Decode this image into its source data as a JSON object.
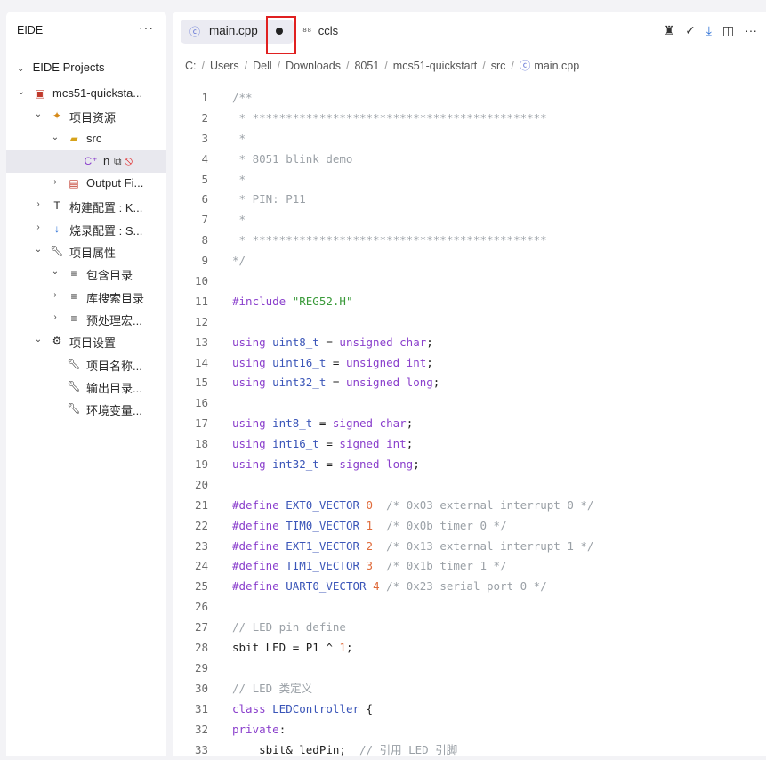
{
  "sidebar": {
    "title": "EIDE",
    "more": "···",
    "section": "EIDE Projects",
    "items": [
      {
        "label": "mcs51-quicksta...",
        "depth": 0,
        "chev": "⌄",
        "icon": "project-icon"
      },
      {
        "label": "项目资源",
        "depth": 1,
        "chev": "⌄",
        "icon": "resources-icon"
      },
      {
        "label": "src",
        "depth": 2,
        "chev": "⌄",
        "icon": "folder-icon"
      },
      {
        "label": "n",
        "depth": 3,
        "chev": "",
        "icon": "cpp-file-icon",
        "selected": true
      },
      {
        "label": "Output Fi...",
        "depth": 2,
        "chev": "›",
        "icon": "output-icon"
      },
      {
        "label": "构建配置 : K...",
        "depth": 1,
        "chev": "›",
        "icon": "build-icon"
      },
      {
        "label": "烧录配置 : S...",
        "depth": 1,
        "chev": "›",
        "icon": "flash-icon"
      },
      {
        "label": "项目属性",
        "depth": 1,
        "chev": "⌄",
        "icon": "wrench-icon"
      },
      {
        "label": "包含目录",
        "depth": 2,
        "chev": "⌄",
        "icon": "list-icon"
      },
      {
        "label": "库搜索目录",
        "depth": 2,
        "chev": "›",
        "icon": "list-icon"
      },
      {
        "label": "预处理宏...",
        "depth": 2,
        "chev": "›",
        "icon": "list-icon"
      },
      {
        "label": "项目设置",
        "depth": 1,
        "chev": "⌄",
        "icon": "gear-icon"
      },
      {
        "label": "项目名称...",
        "depth": 2,
        "chev": "",
        "icon": "wrench-icon"
      },
      {
        "label": "输出目录...",
        "depth": 2,
        "chev": "",
        "icon": "wrench-icon"
      },
      {
        "label": "环境变量...",
        "depth": 2,
        "chev": "",
        "icon": "wrench-icon"
      }
    ]
  },
  "tabs": {
    "active": {
      "label": "main.cpp",
      "modified": true,
      "icon": "cpp-file-icon"
    },
    "second": {
      "label": "ccls",
      "icon": "ccls-icon"
    }
  },
  "actions": [
    "build-icon",
    "clean-icon",
    "download-icon",
    "split-editor-icon",
    "more-icon"
  ],
  "breadcrumb": [
    "C:",
    "Users",
    "Dell",
    "Downloads",
    "8051",
    "mcs51-quickstart",
    "src",
    "main.cpp"
  ],
  "code_lines": [
    [
      [
        "c-com",
        "/**"
      ]
    ],
    [
      [
        "c-com",
        " * ********************************************"
      ]
    ],
    [
      [
        "c-com",
        " *"
      ]
    ],
    [
      [
        "c-com",
        " * 8051 blink demo"
      ]
    ],
    [
      [
        "c-com",
        " *"
      ]
    ],
    [
      [
        "c-com",
        " * PIN: P11"
      ]
    ],
    [
      [
        "c-com",
        " *"
      ]
    ],
    [
      [
        "c-com",
        " * ********************************************"
      ]
    ],
    [
      [
        "c-com",
        "*/"
      ]
    ],
    [],
    [
      [
        "c-pp",
        "#include "
      ],
      [
        "c-str",
        "\"REG52.H\""
      ]
    ],
    [],
    [
      [
        "c-kw",
        "using "
      ],
      [
        "c-mac",
        "uint8_t"
      ],
      [
        "c-plain",
        " = "
      ],
      [
        "c-kw",
        "unsigned char"
      ],
      [
        "c-plain",
        ";"
      ]
    ],
    [
      [
        "c-kw",
        "using "
      ],
      [
        "c-mac",
        "uint16_t"
      ],
      [
        "c-plain",
        " = "
      ],
      [
        "c-kw",
        "unsigned int"
      ],
      [
        "c-plain",
        ";"
      ]
    ],
    [
      [
        "c-kw",
        "using "
      ],
      [
        "c-mac",
        "uint32_t"
      ],
      [
        "c-plain",
        " = "
      ],
      [
        "c-kw",
        "unsigned long"
      ],
      [
        "c-plain",
        ";"
      ]
    ],
    [],
    [
      [
        "c-kw",
        "using "
      ],
      [
        "c-mac",
        "int8_t"
      ],
      [
        "c-plain",
        " = "
      ],
      [
        "c-kw",
        "signed char"
      ],
      [
        "c-plain",
        ";"
      ]
    ],
    [
      [
        "c-kw",
        "using "
      ],
      [
        "c-mac",
        "int16_t"
      ],
      [
        "c-plain",
        " = "
      ],
      [
        "c-kw",
        "signed int"
      ],
      [
        "c-plain",
        ";"
      ]
    ],
    [
      [
        "c-kw",
        "using "
      ],
      [
        "c-mac",
        "int32_t"
      ],
      [
        "c-plain",
        " = "
      ],
      [
        "c-kw",
        "signed long"
      ],
      [
        "c-plain",
        ";"
      ]
    ],
    [],
    [
      [
        "c-pp",
        "#define "
      ],
      [
        "c-mac",
        "EXT0_VECTOR"
      ],
      [
        "c-plain",
        " "
      ],
      [
        "c-num",
        "0"
      ],
      [
        "c-com",
        "  /* 0x03 external interrupt 0 */"
      ]
    ],
    [
      [
        "c-pp",
        "#define "
      ],
      [
        "c-mac",
        "TIM0_VECTOR"
      ],
      [
        "c-plain",
        " "
      ],
      [
        "c-num",
        "1"
      ],
      [
        "c-com",
        "  /* 0x0b timer 0 */"
      ]
    ],
    [
      [
        "c-pp",
        "#define "
      ],
      [
        "c-mac",
        "EXT1_VECTOR"
      ],
      [
        "c-plain",
        " "
      ],
      [
        "c-num",
        "2"
      ],
      [
        "c-com",
        "  /* 0x13 external interrupt 1 */"
      ]
    ],
    [
      [
        "c-pp",
        "#define "
      ],
      [
        "c-mac",
        "TIM1_VECTOR"
      ],
      [
        "c-plain",
        " "
      ],
      [
        "c-num",
        "3"
      ],
      [
        "c-com",
        "  /* 0x1b timer 1 */"
      ]
    ],
    [
      [
        "c-pp",
        "#define "
      ],
      [
        "c-mac",
        "UART0_VECTOR"
      ],
      [
        "c-plain",
        " "
      ],
      [
        "c-num",
        "4"
      ],
      [
        "c-com",
        " /* 0x23 serial port 0 */"
      ]
    ],
    [],
    [
      [
        "c-com",
        "// LED pin define"
      ]
    ],
    [
      [
        "c-id",
        "sbit LED = P1 ^ "
      ],
      [
        "c-num",
        "1"
      ],
      [
        "c-plain",
        ";"
      ]
    ],
    [],
    [
      [
        "c-com",
        "// LED 类定义"
      ]
    ],
    [
      [
        "c-kw",
        "class "
      ],
      [
        "c-mac",
        "LEDController"
      ],
      [
        "c-plain",
        " {"
      ]
    ],
    [
      [
        "c-kw",
        "private"
      ],
      [
        "c-plain",
        ":"
      ]
    ],
    [
      [
        "c-plain",
        "    sbit& ledPin;  "
      ],
      [
        "c-com",
        "// 引用 LED 引脚"
      ]
    ]
  ]
}
